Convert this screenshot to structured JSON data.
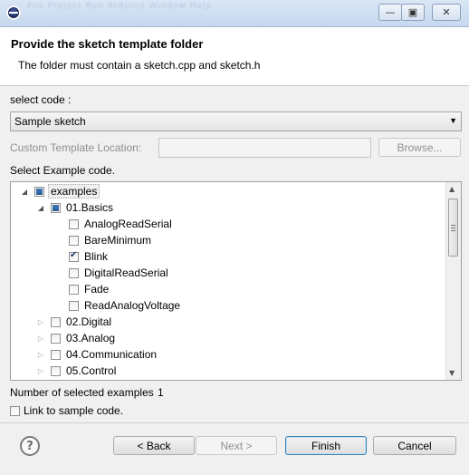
{
  "window": {
    "ghost_menu": "File  Project  Run  Arduino  Window  Help",
    "minimize_label": "—",
    "maximize_label": "▣",
    "close_label": "✕"
  },
  "header": {
    "title": "Provide the sketch template folder",
    "description": "The folder must contain a sketch.cpp and sketch.h"
  },
  "form": {
    "select_code_label": "select code :",
    "select_code_value": "Sample sketch",
    "custom_location_label": "Custom Template Location:",
    "custom_location_value": "",
    "browse_label": "Browse...",
    "select_example_label": "Select Example code."
  },
  "tree": {
    "root": {
      "label": "examples",
      "state": "partial",
      "expanded": true
    },
    "basics": {
      "label": "01.Basics",
      "state": "partial",
      "expanded": true
    },
    "basics_items": [
      {
        "label": "AnalogReadSerial",
        "checked": false
      },
      {
        "label": "BareMinimum",
        "checked": false
      },
      {
        "label": "Blink",
        "checked": true
      },
      {
        "label": "DigitalReadSerial",
        "checked": false
      },
      {
        "label": "Fade",
        "checked": false
      },
      {
        "label": "ReadAnalogVoltage",
        "checked": false
      }
    ],
    "folders": [
      {
        "label": "02.Digital"
      },
      {
        "label": "03.Analog"
      },
      {
        "label": "04.Communication"
      },
      {
        "label": "05.Control"
      }
    ]
  },
  "summary": {
    "selected_count_label": "Number of selected examples",
    "selected_count": "1",
    "link_label": "Link to sample code."
  },
  "buttons": {
    "back": "< Back",
    "next": "Next >",
    "finish": "Finish",
    "cancel": "Cancel",
    "help": "?"
  },
  "icons": [
    "app-icon",
    "help-icon",
    "chevron-down-icon",
    "expand-arrow-icon",
    "collapse-arrow-icon"
  ]
}
